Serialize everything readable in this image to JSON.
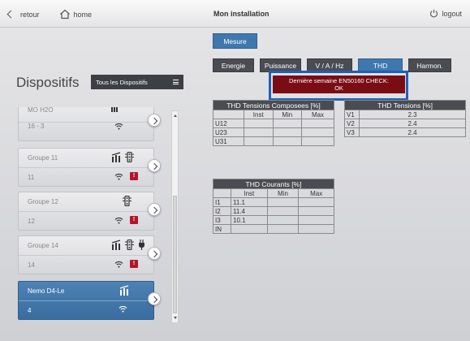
{
  "topbar": {
    "back_label": "retour",
    "home_label": "home",
    "title": "Mon installation",
    "logout_label": "logout"
  },
  "left": {
    "title": "Dispositifs",
    "filter_label": "Tous les Dispositifs",
    "partial_card": {
      "name": "MO H2O",
      "num": "16 - 3"
    },
    "cards": [
      {
        "name": "Groupe 11",
        "num": "11",
        "icons": [
          "meter-icon",
          "traffic-light-icon"
        ],
        "alert": "!"
      },
      {
        "name": "Groupe 12",
        "num": "12",
        "icons": [
          "traffic-light-icon"
        ],
        "alert": "!"
      },
      {
        "name": "Groupe 14",
        "num": "14",
        "icons": [
          "meter-icon",
          "traffic-light-icon",
          "plug-icon"
        ],
        "alert": "!"
      },
      {
        "name": "Nemo D4-Le",
        "num": "4",
        "icons": [
          "meter-icon"
        ],
        "alert": null,
        "active": true
      }
    ]
  },
  "main": {
    "mesure_label": "Mesure",
    "tabs": [
      {
        "label": "Energie"
      },
      {
        "label": "Puissance"
      },
      {
        "label": "V / A / Hz"
      },
      {
        "label": "THD",
        "selected": true
      },
      {
        "label": "Harmon."
      }
    ],
    "alert_line1": "Dernière semaine EN50160 CHECK:",
    "alert_line2": "OK",
    "thd_composees": {
      "title": "THD Tensions Composees [%]",
      "headers": [
        "",
        "Inst",
        "Min",
        "Max"
      ],
      "rows": [
        "U12",
        "U23",
        "U31"
      ]
    },
    "thd_tensions": {
      "title": "THD Tensions [%]",
      "rows": [
        {
          "label": "V1",
          "value": "2.3"
        },
        {
          "label": "V2",
          "value": "2.4"
        },
        {
          "label": "V3",
          "value": "2.4"
        }
      ]
    },
    "thd_courants": {
      "title": "THD Courants [%]",
      "headers": [
        "",
        "Inst",
        "Min",
        "Max"
      ],
      "rows": [
        {
          "label": "I1",
          "inst": "11.1"
        },
        {
          "label": "I2",
          "inst": "11.4"
        },
        {
          "label": "I3",
          "inst": "10.1"
        },
        {
          "label": "IN",
          "inst": ""
        }
      ]
    }
  }
}
